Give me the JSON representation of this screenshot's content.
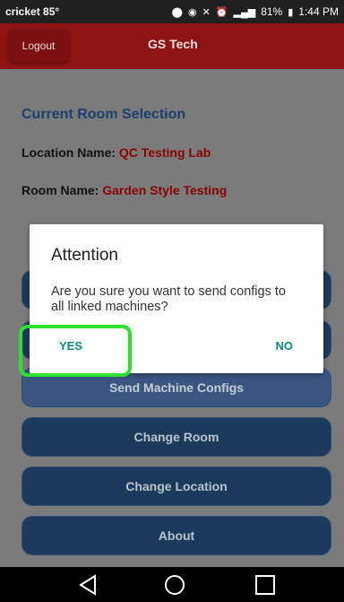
{
  "status_bar": {
    "carrier": "cricket 85°",
    "battery": "81%",
    "time": "1:44 PM"
  },
  "app_bar": {
    "logout_label": "Logout",
    "title": "GS Tech"
  },
  "content": {
    "section_title": "Current Room Selection",
    "location_label": "Location Name:",
    "location_value": "QC Testing Lab",
    "room_label": "Room Name:",
    "room_value": "Garden Style Testing",
    "buttons": {
      "send_configs": "Send Machine Configs",
      "change_room": "Change Room",
      "change_location": "Change Location",
      "about": "About"
    }
  },
  "dialog": {
    "title": "Attention",
    "message": "Are you sure you want to send configs to all linked machines?",
    "yes": "YES",
    "no": "NO"
  },
  "colors": {
    "app_bar": "#8c1414",
    "button": "#1c3a5c",
    "accent": "#0b8a83",
    "highlight": "#2fe12f"
  }
}
